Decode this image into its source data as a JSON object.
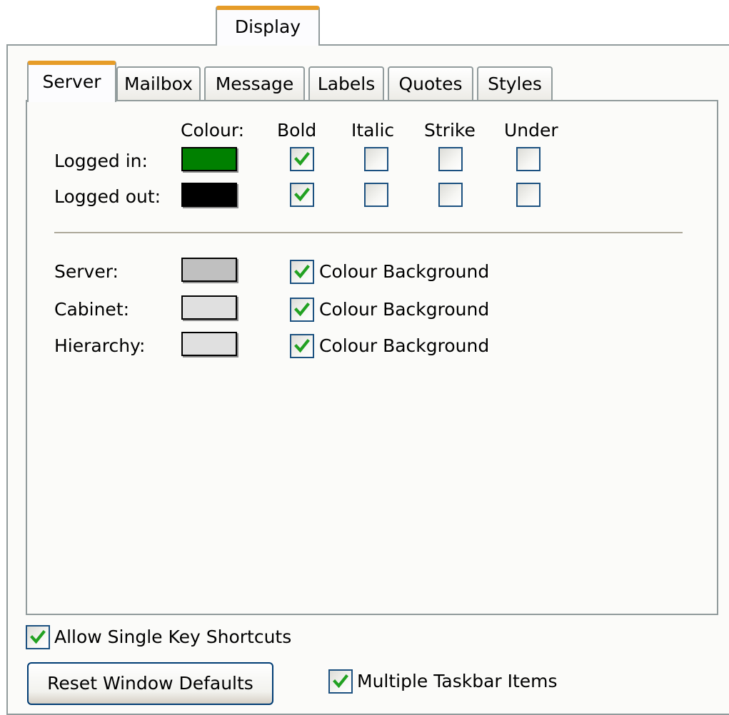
{
  "outer_tab": {
    "label": "Display"
  },
  "tabs": [
    {
      "label": "Server",
      "active": true
    },
    {
      "label": "Mailbox",
      "active": false
    },
    {
      "label": "Message",
      "active": false
    },
    {
      "label": "Labels",
      "active": false
    },
    {
      "label": "Quotes",
      "active": false
    },
    {
      "label": "Styles",
      "active": false
    }
  ],
  "columns": {
    "colour": "Colour:",
    "bold": "Bold",
    "italic": "Italic",
    "strike": "Strike",
    "under": "Under"
  },
  "status_rows": [
    {
      "label": "Logged in:",
      "colour": "#008000",
      "bold": true,
      "italic": false,
      "strike": false,
      "under": false
    },
    {
      "label": "Logged out:",
      "colour": "#000000",
      "bold": true,
      "italic": false,
      "strike": false,
      "under": false
    }
  ],
  "background_rows": [
    {
      "label": "Server:",
      "colour": "#c0c0c0",
      "checkbox_label": "Colour Background",
      "checked": true
    },
    {
      "label": "Cabinet:",
      "colour": "#e0e0e0",
      "checkbox_label": "Colour Background",
      "checked": true
    },
    {
      "label": "Hierarchy:",
      "colour": "#e0e0e0",
      "checkbox_label": "Colour Background",
      "checked": true
    }
  ],
  "options": {
    "single_key_label": "Allow Single Key Shortcuts",
    "single_key_checked": true,
    "taskbar_label": "Multiple Taskbar Items",
    "taskbar_checked": true
  },
  "buttons": {
    "reset_label": "Reset Window Defaults"
  },
  "theme": {
    "tab_accent": "#e69c28",
    "border": "#919b9c",
    "checkbox_border": "#1c5180",
    "check_mark": "#21a121"
  }
}
